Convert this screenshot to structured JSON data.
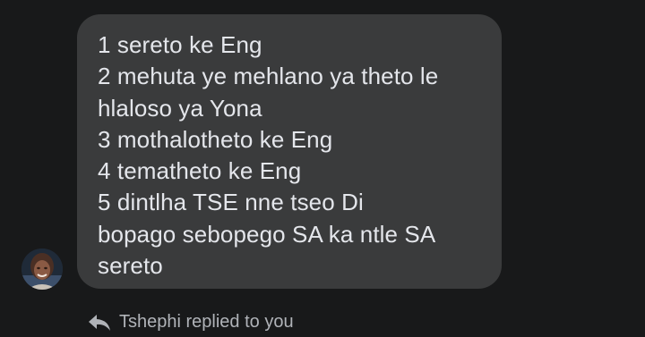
{
  "message": {
    "lines": [
      "1 sereto ke Eng",
      "2 mehuta ye mehlano ya theto le",
      "hlaloso ya Yona",
      "3 mothalotheto  ke Eng",
      "4 tematheto ke Eng",
      "5 dintlha TSE nne tseo Di",
      "bopago sebopego SA ka ntle SA",
      "sereto"
    ]
  },
  "reply_status": {
    "text": "Tshephi replied to you",
    "icon": "reply-arrow-icon"
  },
  "colors": {
    "background": "#18191a",
    "bubble": "#3a3b3c",
    "message_text": "#e4e6eb",
    "status_text": "#b0b3b8"
  }
}
